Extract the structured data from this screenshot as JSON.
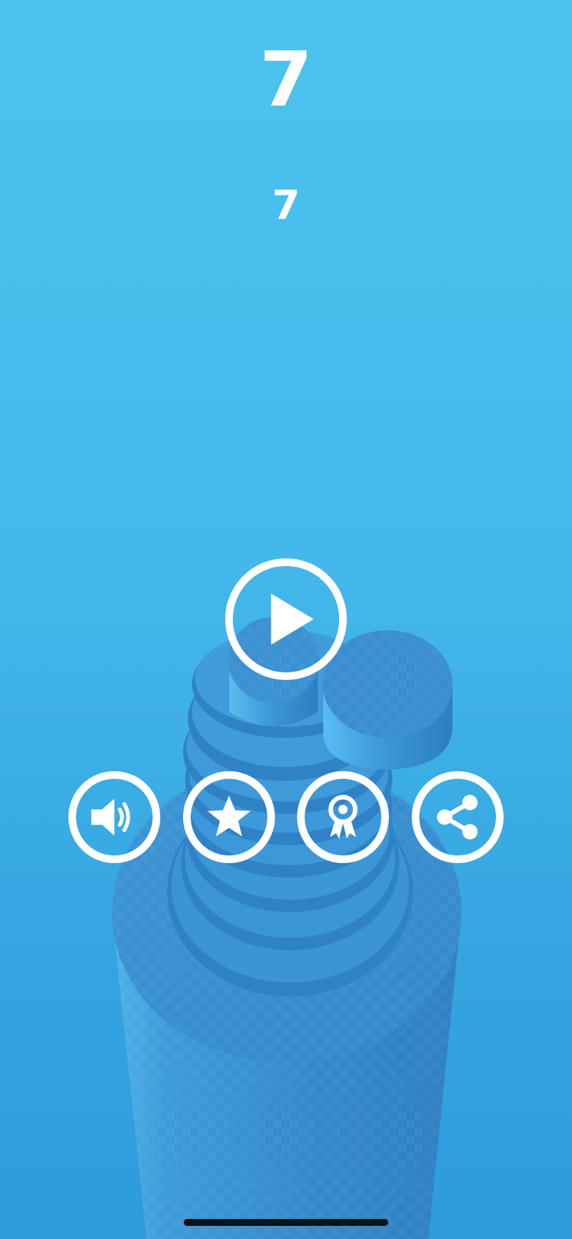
{
  "hud": {
    "score": "7",
    "best_score": "7"
  },
  "menu": {
    "play_icon": "play-icon",
    "sound_icon": "speaker-icon",
    "rate_icon": "star-icon",
    "achievements_icon": "ribbon-award-icon",
    "share_icon": "share-icon"
  },
  "colors": {
    "sky_top": "#4cc3ef",
    "sky_bottom": "#2d9bdc",
    "tower": "#3a93d3",
    "ui_white": "#ffffff"
  }
}
